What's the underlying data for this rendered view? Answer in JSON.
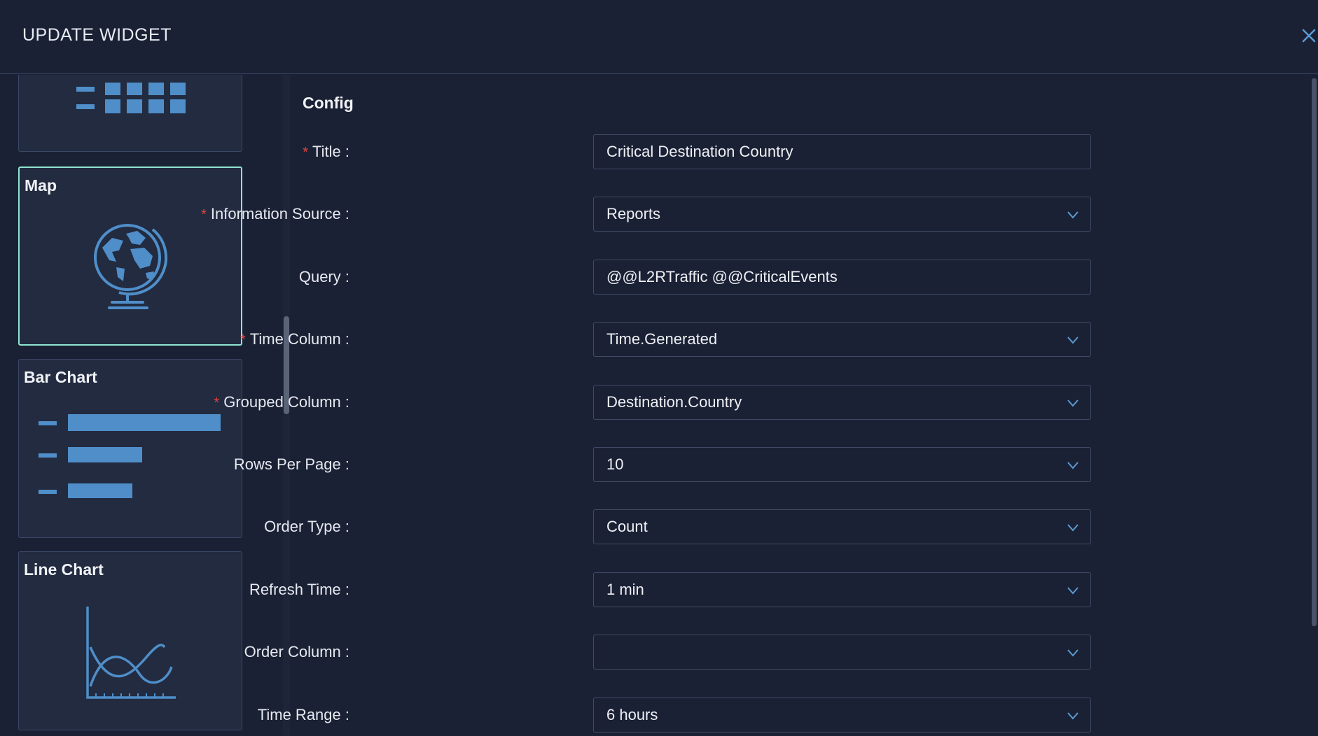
{
  "header": {
    "title": "UPDATE WIDGET"
  },
  "widgets": {
    "map_label": "Map",
    "bar_label": "Bar Chart",
    "line_label": "Line Chart"
  },
  "config": {
    "heading": "Config",
    "fields": [
      {
        "label": "Title",
        "required": true,
        "value": "Critical Destination Country",
        "type": "input"
      },
      {
        "label": "Information Source",
        "required": true,
        "value": "Reports",
        "type": "select"
      },
      {
        "label": "Query",
        "required": false,
        "value": "@@L2RTraffic @@CriticalEvents",
        "type": "input"
      },
      {
        "label": "Time Column",
        "required": true,
        "value": "Time.Generated",
        "type": "select"
      },
      {
        "label": "Grouped Column",
        "required": true,
        "value": "Destination.Country",
        "type": "select"
      },
      {
        "label": "Rows Per Page",
        "required": false,
        "value": "10",
        "type": "select"
      },
      {
        "label": "Order Type",
        "required": false,
        "value": "Count",
        "type": "select"
      },
      {
        "label": "Refresh Time",
        "required": false,
        "value": "1 min",
        "type": "select"
      },
      {
        "label": "Order Column",
        "required": false,
        "value": "",
        "type": "select"
      },
      {
        "label": "Time Range",
        "required": false,
        "value": "6 hours",
        "type": "select"
      }
    ]
  },
  "colors": {
    "accent": "#5a9bd4",
    "selected_border": "#8fe4d0",
    "required": "#e0453e"
  }
}
